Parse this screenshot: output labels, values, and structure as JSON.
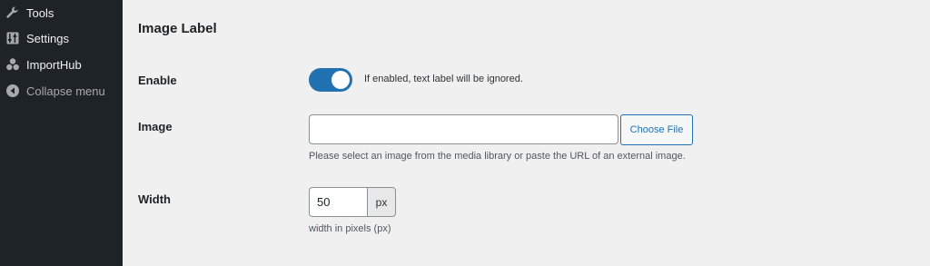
{
  "sidebar": {
    "items": [
      {
        "label": "Tools",
        "icon": "wrench-icon"
      },
      {
        "label": "Settings",
        "icon": "settings-icon"
      },
      {
        "label": "ImportHub",
        "icon": "importhub-icon"
      },
      {
        "label": "Collapse menu",
        "icon": "collapse-icon"
      }
    ]
  },
  "main": {
    "section_title": "Image Label",
    "enable": {
      "label": "Enable",
      "toggle_on": true,
      "description": "If enabled, text label will be ignored."
    },
    "image": {
      "label": "Image",
      "value": "",
      "button_label": "Choose File",
      "help": "Please select an image from the media library or paste the URL of an external image."
    },
    "width": {
      "label": "Width",
      "value": "50",
      "unit": "px",
      "help": "width in pixels (px)"
    }
  },
  "colors": {
    "sidebar_bg": "#1d2327",
    "accent": "#2271b1",
    "page_bg": "#f0f0f1"
  }
}
